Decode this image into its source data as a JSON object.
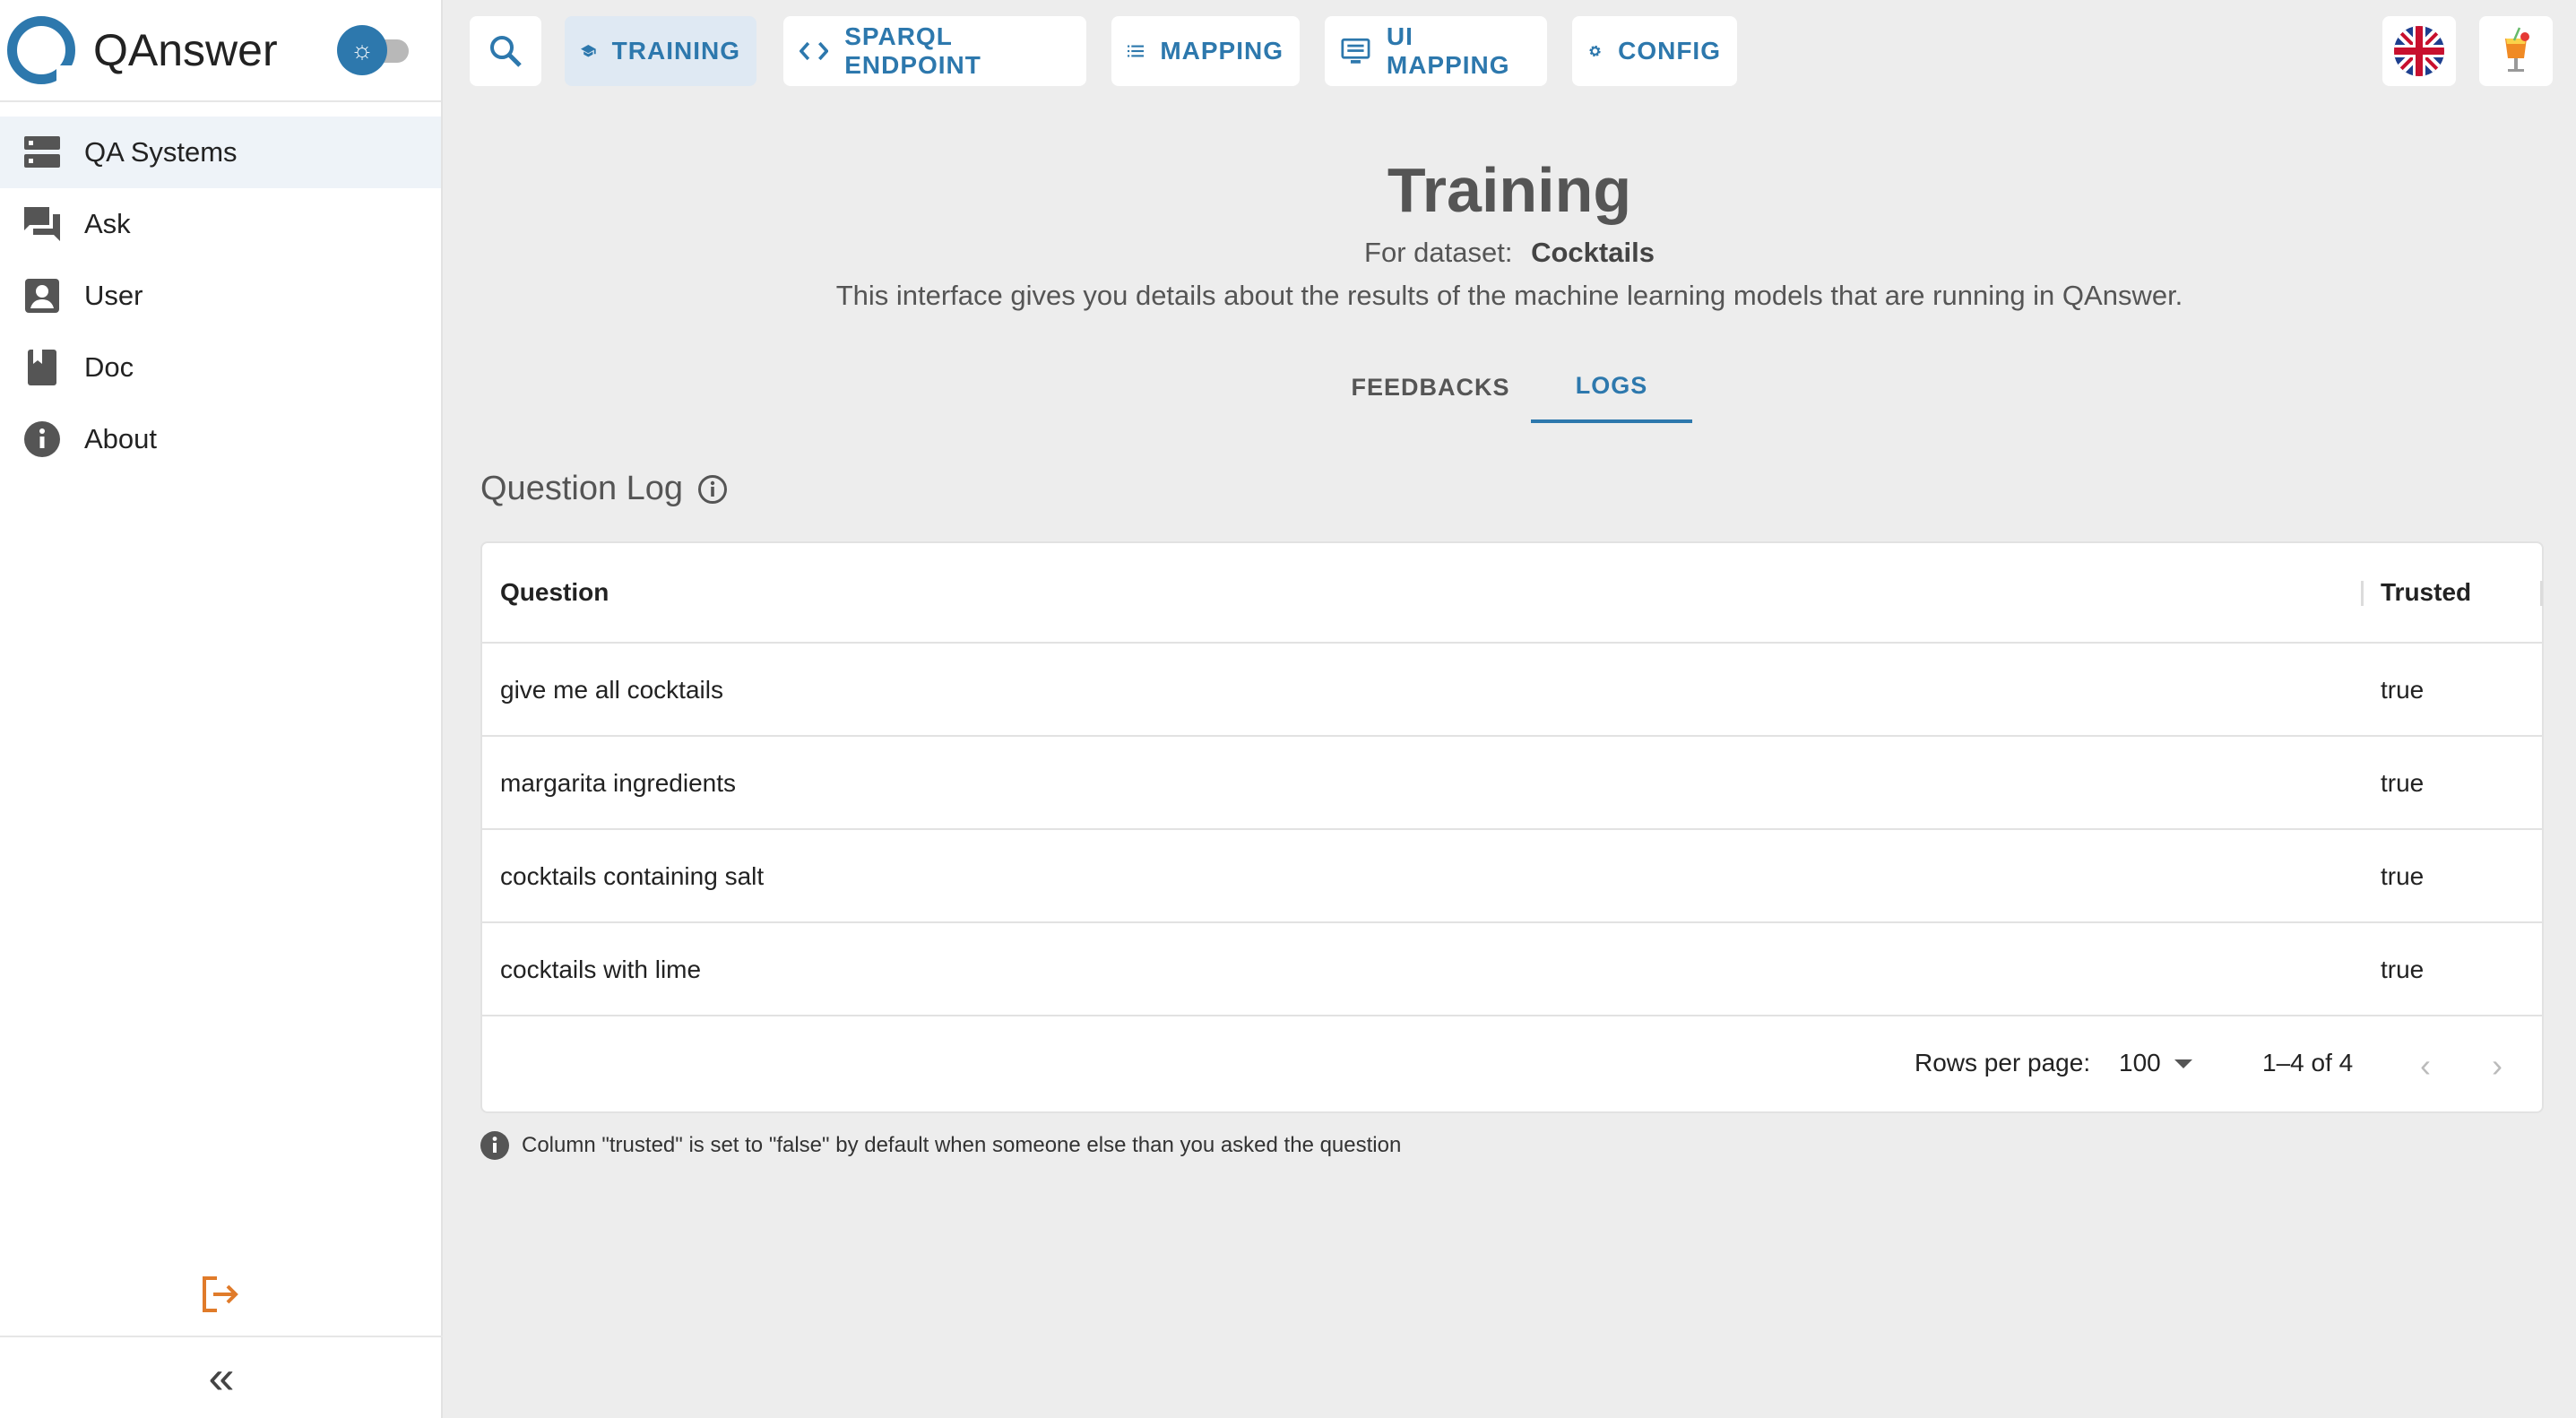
{
  "app": {
    "name": "QAnswer"
  },
  "sidebar": {
    "items": [
      {
        "label": "QA Systems",
        "icon": "storage-icon"
      },
      {
        "label": "Ask",
        "icon": "forum-icon"
      },
      {
        "label": "User",
        "icon": "account-box-icon"
      },
      {
        "label": "Doc",
        "icon": "book-icon"
      },
      {
        "label": "About",
        "icon": "info-icon"
      }
    ],
    "collapse_label": "«"
  },
  "topbar": {
    "buttons": [
      {
        "label": "TRAINING",
        "icon": "school-icon"
      },
      {
        "label": "SPARQL ENDPOINT",
        "icon": "code-icon"
      },
      {
        "label": "MAPPING",
        "icon": "list-icon"
      },
      {
        "label": "UI MAPPING",
        "icon": "monitor-list-icon"
      },
      {
        "label": "CONFIG",
        "icon": "gear-icon"
      }
    ]
  },
  "page": {
    "title": "Training",
    "dataset_prefix": "For dataset:",
    "dataset_name": "Cocktails",
    "description": "This interface gives you details about the results of the machine learning models that are running in QAnswer."
  },
  "tabs": [
    {
      "label": "FEEDBACKS",
      "active": false
    },
    {
      "label": "LOGS",
      "active": true
    }
  ],
  "question_log": {
    "title": "Question Log",
    "columns": [
      "Question",
      "Trusted"
    ],
    "rows": [
      {
        "question": "give me all cocktails",
        "trusted": "true"
      },
      {
        "question": "margarita ingredients",
        "trusted": "true"
      },
      {
        "question": "cocktails containing salt",
        "trusted": "true"
      },
      {
        "question": "cocktails with lime",
        "trusted": "true"
      }
    ],
    "pagination": {
      "rows_per_page_label": "Rows per page:",
      "rows_per_page": "100",
      "range": "1–4 of 4"
    },
    "note": "Column \"trusted\" is set to \"false\" by default when someone else than you asked the question"
  },
  "colors": {
    "accent": "#2d78ad",
    "logout": "#e07b2a"
  }
}
